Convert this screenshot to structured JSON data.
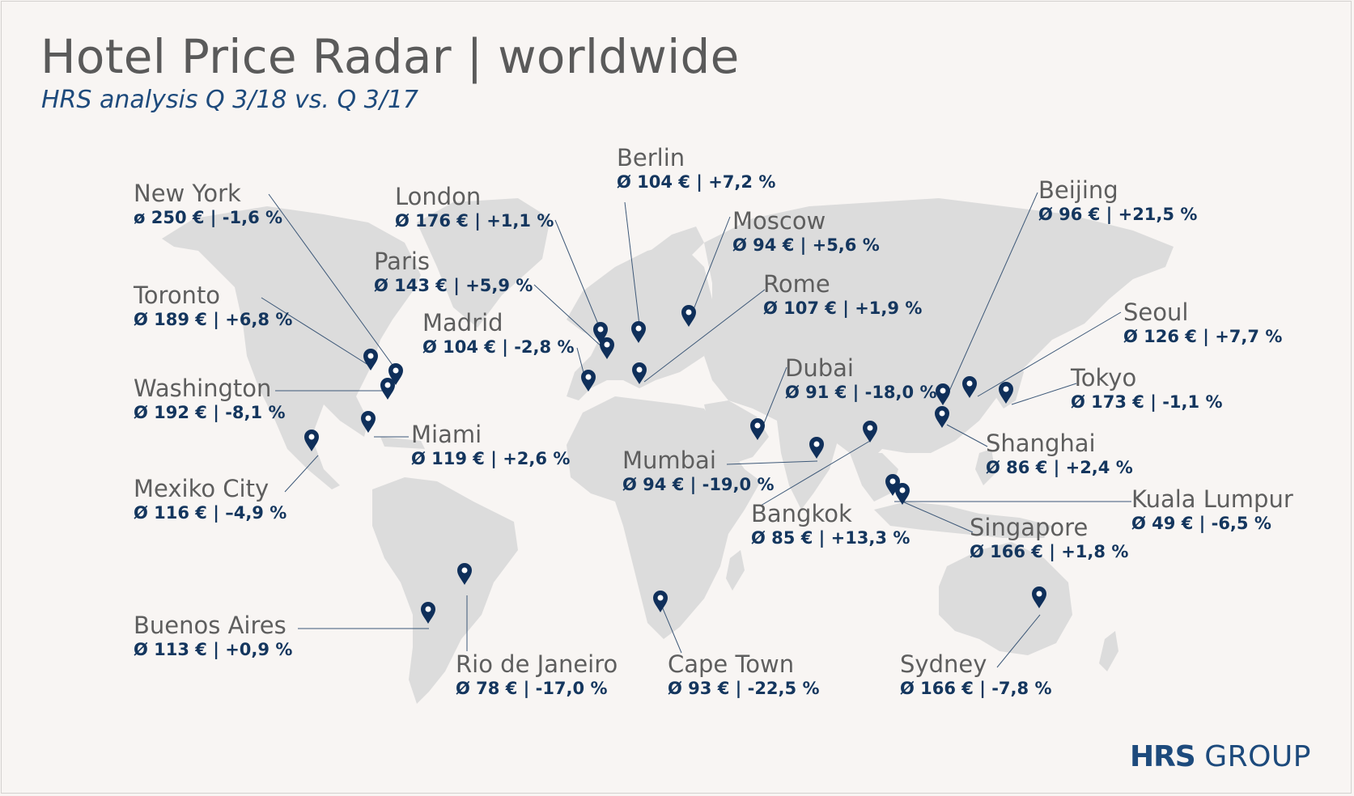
{
  "header": {
    "title": "Hotel Price Radar | worldwide",
    "subtitle": "HRS analysis Q 3/18 vs. Q 3/17"
  },
  "colors": {
    "background": "#f8f5f3",
    "land": "#dcdcdc",
    "marker": "#0f2f5a",
    "leader_line": "#3d5878",
    "title": "#5a5a5a",
    "subtitle": "#1d4a7c"
  },
  "cities": [
    {
      "name": "New York",
      "stats": "ø 250 € | -1,6 %"
    },
    {
      "name": "Toronto",
      "stats": "Ø 189 € | +6,8 %"
    },
    {
      "name": "Washington",
      "stats": "Ø 192 € | -8,1 %"
    },
    {
      "name": "Miami",
      "stats": "Ø 119 € | +2,6 %"
    },
    {
      "name": "Mexiko City",
      "stats": "Ø 116 € | –4,9 %"
    },
    {
      "name": "Buenos Aires",
      "stats": "Ø 113 € | +0,9 %"
    },
    {
      "name": "Rio de Janeiro",
      "stats": "Ø 78 € | -17,0 %"
    },
    {
      "name": "London",
      "stats": "Ø 176 € | +1,1 %"
    },
    {
      "name": "Paris",
      "stats": "Ø 143 € | +5,9 %"
    },
    {
      "name": "Madrid",
      "stats": "Ø 104 € | -2,8 %"
    },
    {
      "name": "Berlin",
      "stats": "Ø 104 € | +7,2 %"
    },
    {
      "name": "Moscow",
      "stats": "Ø 94 € | +5,6 %"
    },
    {
      "name": "Rome",
      "stats": "Ø 107 € | +1,9 %"
    },
    {
      "name": "Dubai",
      "stats": "Ø 91 € | -18,0 %"
    },
    {
      "name": "Mumbai",
      "stats": "Ø 94 € | -19,0 %"
    },
    {
      "name": "Bangkok",
      "stats": "Ø 85 € | +13,3 %"
    },
    {
      "name": "Cape Town",
      "stats": "Ø 93 € | -22,5 %"
    },
    {
      "name": "Beijing",
      "stats": "Ø 96 € | +21,5 %"
    },
    {
      "name": "Seoul",
      "stats": "Ø 126 € | +7,7 %"
    },
    {
      "name": "Tokyo",
      "stats": "Ø 173 € | -1,1 %"
    },
    {
      "name": "Shanghai",
      "stats": "Ø 86 € | +2,4 %"
    },
    {
      "name": "Kuala Lumpur",
      "stats": "Ø 49 € | -6,5 %"
    },
    {
      "name": "Singapore",
      "stats": "Ø 166 € | +1,8 %"
    },
    {
      "name": "Sydney",
      "stats": "Ø 166 € | -7,8 %"
    }
  ],
  "logo": {
    "bold": "HRS",
    "regular": "GROUP"
  }
}
